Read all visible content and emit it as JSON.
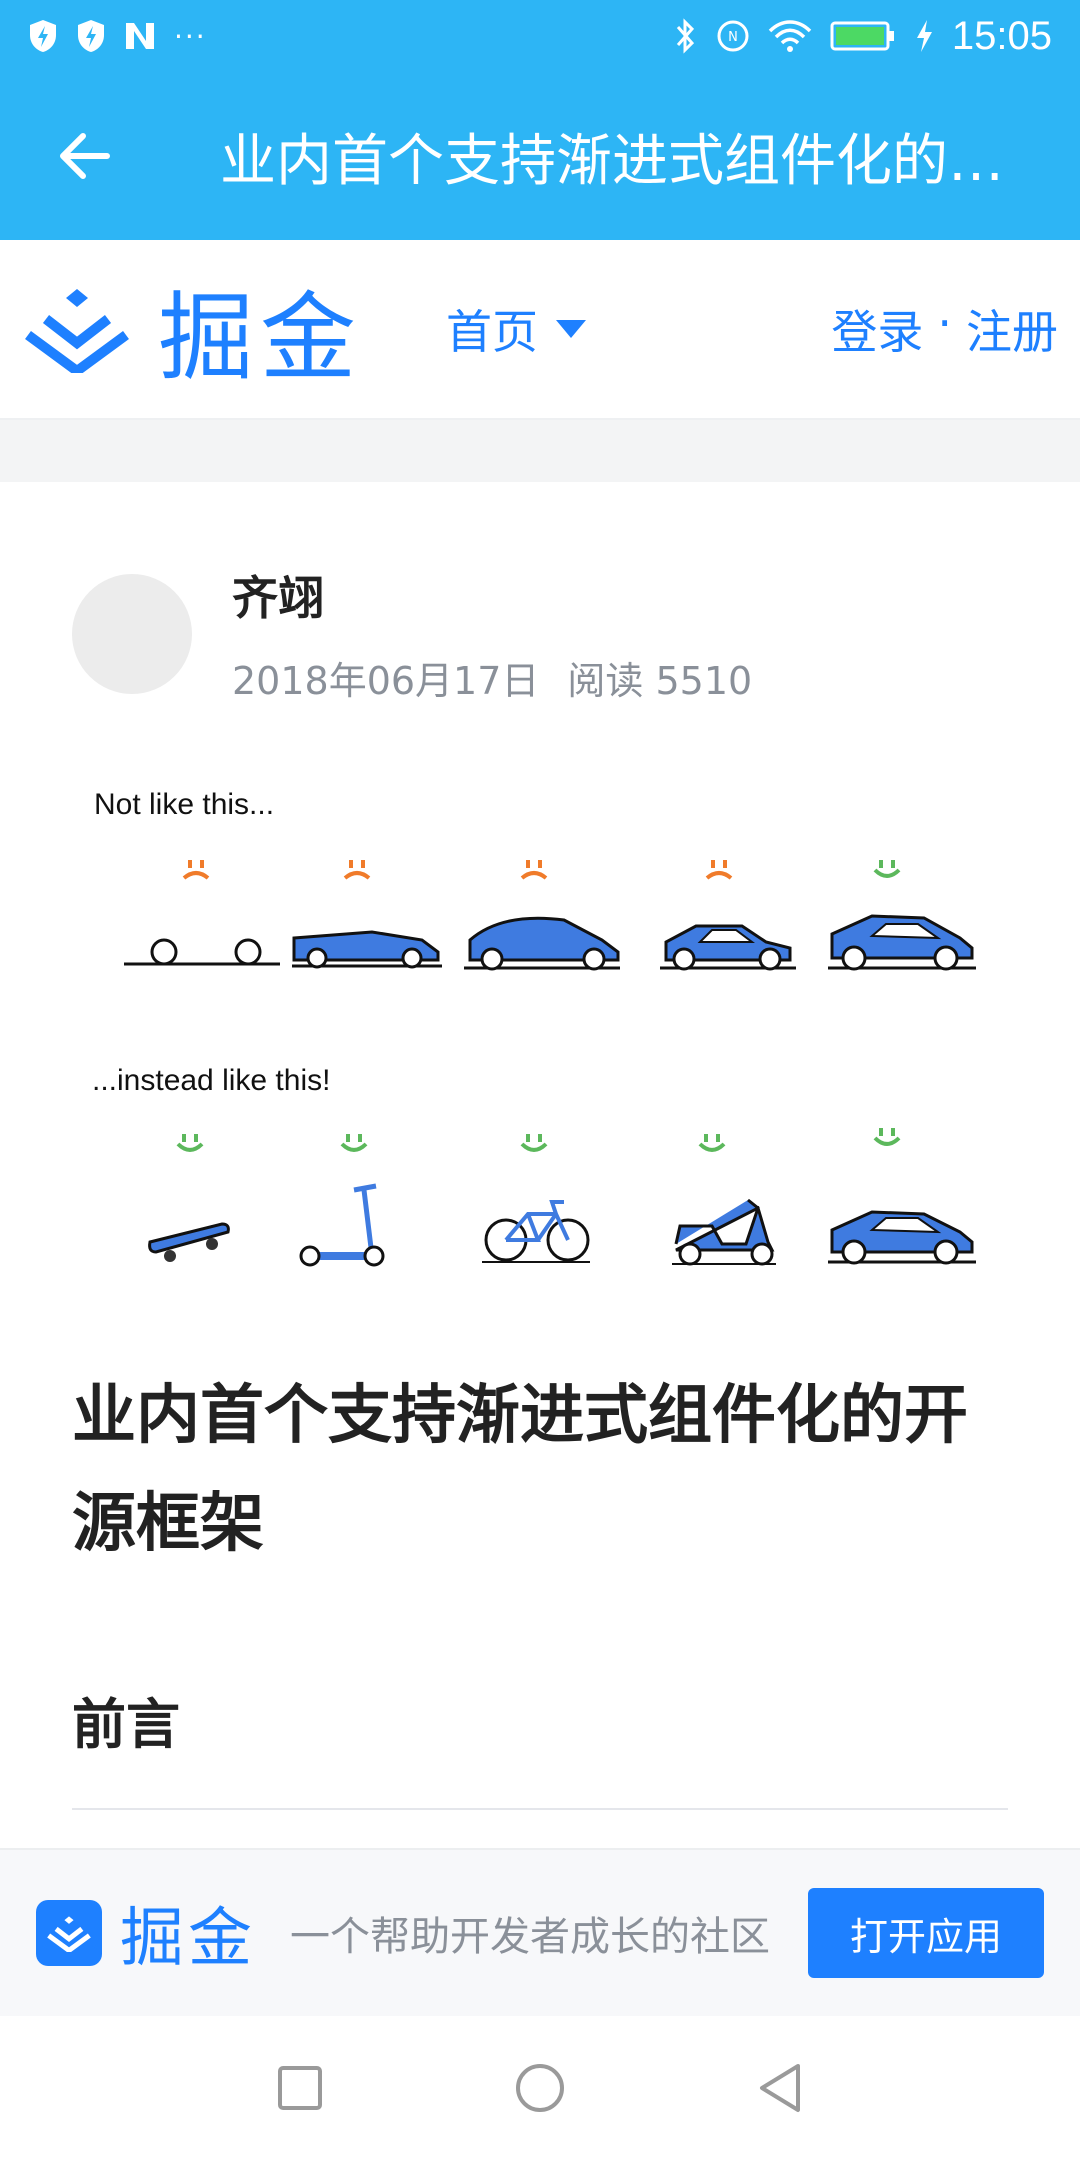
{
  "status_bar": {
    "time": "15:05",
    "dots": "···",
    "icons": [
      "shield-bolt-icon",
      "shield-bolt-icon",
      "n-logo-icon",
      "bluetooth-icon",
      "nfc-icon",
      "wifi-icon",
      "battery-icon",
      "charging-icon"
    ]
  },
  "title_bar": {
    "title": "业内首个支持渐进式组件化的…",
    "back_icon": "arrow-left-icon"
  },
  "site_header": {
    "logo_text": "掘金",
    "nav_home": "首页",
    "login": "登录",
    "separator": "·",
    "register": "注册"
  },
  "article": {
    "author_name": "齐翊",
    "date": "2018年06月17日",
    "reads": "阅读 5510",
    "hero": {
      "caption_top": "Not like this...",
      "caption_bottom": "...instead like this!"
    },
    "title": "业内首个支持渐进式组件化的开源框架",
    "section_heading": "前言"
  },
  "app_banner": {
    "logo_text": "掘金",
    "slogan": "一个帮助开发者成长的社区",
    "open_button": "打开应用"
  },
  "colors": {
    "header_blue": "#2db5f5",
    "brand_blue": "#1e80ff",
    "sad_face": "#f07b2a",
    "happy_face": "#5cb85c",
    "vehicle_blue": "#3f7be0"
  }
}
